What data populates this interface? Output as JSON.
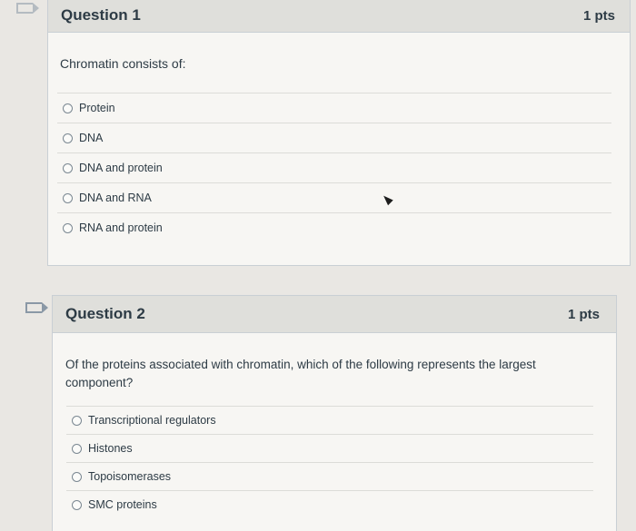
{
  "q1": {
    "title": "Question 1",
    "points": "1 pts",
    "text": "Chromatin consists of:",
    "answers": [
      "Protein",
      "DNA",
      "DNA and protein",
      "DNA and RNA",
      "RNA and protein"
    ]
  },
  "q2": {
    "title": "Question 2",
    "points": "1 pts",
    "text": "Of the proteins associated with chromatin, which of the following represents the largest component?",
    "answers": [
      "Transcriptional regulators",
      "Histones",
      "Topoisomerases",
      "SMC proteins"
    ]
  }
}
